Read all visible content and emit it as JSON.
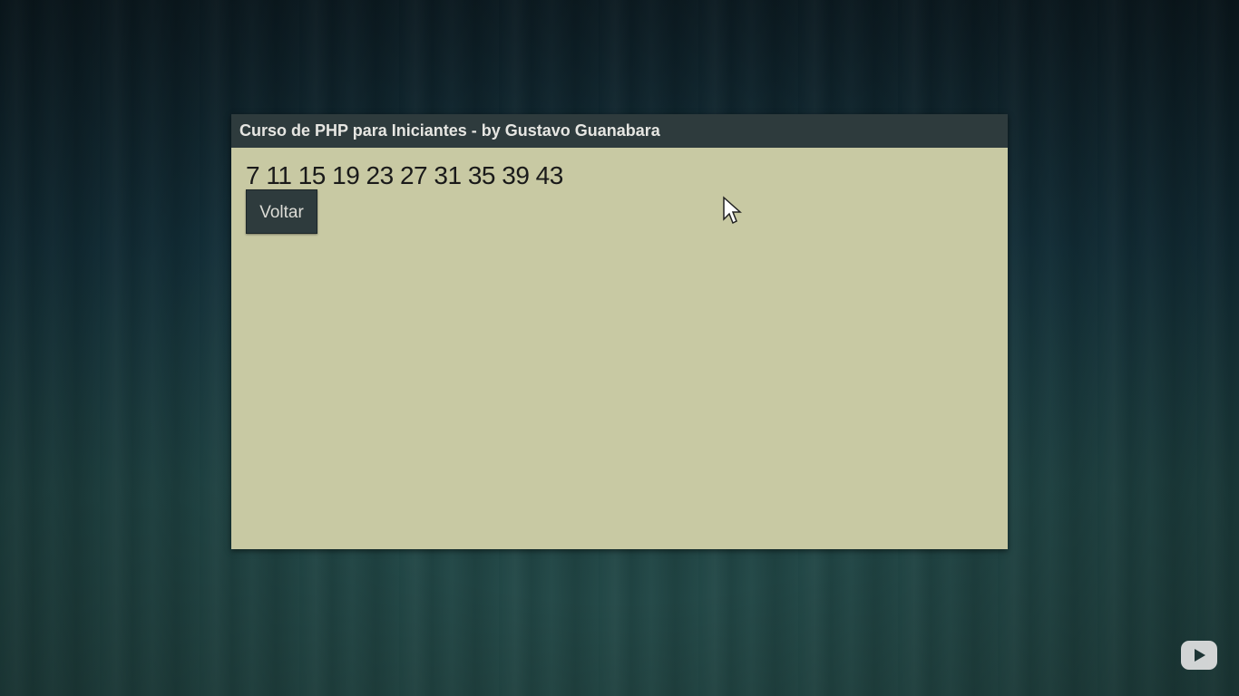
{
  "window": {
    "title": "Curso de PHP para Iniciantes - by Gustavo Guanabara"
  },
  "content": {
    "sequence": "7 11 15 19 23 27 31 35 39 43",
    "back_button_label": "Voltar"
  },
  "icons": {
    "cursor": "mouse-pointer-icon",
    "player": "play-icon"
  },
  "colors": {
    "titlebar": "#2e3b3d",
    "window_bg": "#c8c9a3",
    "button_bg": "#2e3b3d"
  }
}
